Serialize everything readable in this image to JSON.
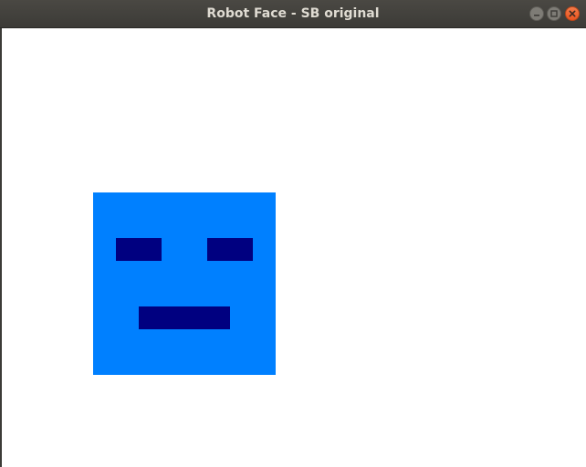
{
  "window": {
    "title": "Robot Face - SB original",
    "controls": {
      "minimize_icon": "minimize-icon",
      "maximize_icon": "maximize-icon",
      "close_icon": "close-icon"
    }
  },
  "canvas": {
    "background_color": "#ffffff",
    "robot_face": {
      "head_color": "#0080ff",
      "eye_color": "#000080",
      "mouth_color": "#000080"
    }
  }
}
